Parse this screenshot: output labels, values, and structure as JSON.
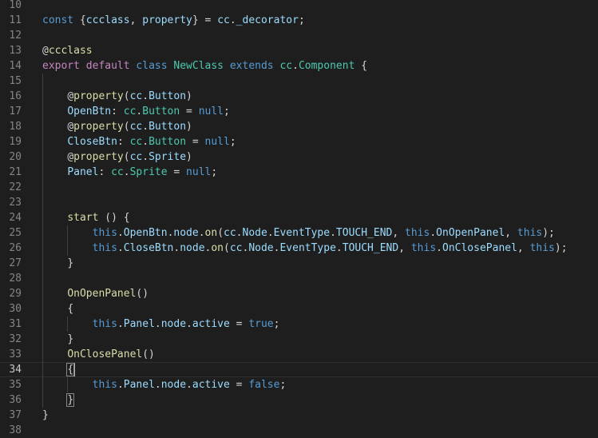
{
  "editor": {
    "current_line": 34,
    "theme_colors": {
      "background": "#1e1e1e",
      "line_number": "#858585",
      "keyword": "#569cd6",
      "storage": "#c586c0",
      "class_name": "#4ec9b0",
      "function": "#dcdcaa",
      "variable": "#9cdcfe",
      "punctuation": "#d4d4d4"
    },
    "lines": [
      {
        "n": "10",
        "indent": 0,
        "tokens": []
      },
      {
        "n": "11",
        "indent": 0,
        "tokens": [
          {
            "t": "const",
            "c": "#569cd6"
          },
          {
            "t": " {",
            "c": "#d4d4d4"
          },
          {
            "t": "ccclass",
            "c": "#9cdcfe"
          },
          {
            "t": ", ",
            "c": "#d4d4d4"
          },
          {
            "t": "property",
            "c": "#9cdcfe"
          },
          {
            "t": "} = ",
            "c": "#d4d4d4"
          },
          {
            "t": "cc",
            "c": "#9cdcfe"
          },
          {
            "t": ".",
            "c": "#d4d4d4"
          },
          {
            "t": "_decorator",
            "c": "#9cdcfe"
          },
          {
            "t": ";",
            "c": "#d4d4d4"
          }
        ]
      },
      {
        "n": "12",
        "indent": 0,
        "tokens": []
      },
      {
        "n": "13",
        "indent": 0,
        "tokens": [
          {
            "t": "@",
            "c": "#d4d4d4"
          },
          {
            "t": "ccclass",
            "c": "#dcdcaa"
          }
        ]
      },
      {
        "n": "14",
        "indent": 0,
        "tokens": [
          {
            "t": "export",
            "c": "#c586c0"
          },
          {
            "t": " ",
            "c": "#d4d4d4"
          },
          {
            "t": "default",
            "c": "#c586c0"
          },
          {
            "t": " ",
            "c": "#d4d4d4"
          },
          {
            "t": "class",
            "c": "#569cd6"
          },
          {
            "t": " ",
            "c": "#d4d4d4"
          },
          {
            "t": "NewClass",
            "c": "#4ec9b0"
          },
          {
            "t": " ",
            "c": "#d4d4d4"
          },
          {
            "t": "extends",
            "c": "#569cd6"
          },
          {
            "t": " ",
            "c": "#d4d4d4"
          },
          {
            "t": "cc",
            "c": "#4ec9b0"
          },
          {
            "t": ".",
            "c": "#d4d4d4"
          },
          {
            "t": "Component",
            "c": "#4ec9b0"
          },
          {
            "t": " {",
            "c": "#d4d4d4"
          }
        ]
      },
      {
        "n": "15",
        "indent": 1,
        "tokens": []
      },
      {
        "n": "16",
        "indent": 1,
        "tokens": [
          {
            "t": "@",
            "c": "#d4d4d4"
          },
          {
            "t": "property",
            "c": "#dcdcaa"
          },
          {
            "t": "(",
            "c": "#d4d4d4"
          },
          {
            "t": "cc",
            "c": "#9cdcfe"
          },
          {
            "t": ".",
            "c": "#d4d4d4"
          },
          {
            "t": "Button",
            "c": "#9cdcfe"
          },
          {
            "t": ")",
            "c": "#d4d4d4"
          }
        ]
      },
      {
        "n": "17",
        "indent": 1,
        "tokens": [
          {
            "t": "OpenBtn",
            "c": "#9cdcfe"
          },
          {
            "t": ": ",
            "c": "#d4d4d4"
          },
          {
            "t": "cc",
            "c": "#4ec9b0"
          },
          {
            "t": ".",
            "c": "#d4d4d4"
          },
          {
            "t": "Button",
            "c": "#4ec9b0"
          },
          {
            "t": " = ",
            "c": "#d4d4d4"
          },
          {
            "t": "null",
            "c": "#569cd6"
          },
          {
            "t": ";",
            "c": "#d4d4d4"
          }
        ]
      },
      {
        "n": "18",
        "indent": 1,
        "tokens": [
          {
            "t": "@",
            "c": "#d4d4d4"
          },
          {
            "t": "property",
            "c": "#dcdcaa"
          },
          {
            "t": "(",
            "c": "#d4d4d4"
          },
          {
            "t": "cc",
            "c": "#9cdcfe"
          },
          {
            "t": ".",
            "c": "#d4d4d4"
          },
          {
            "t": "Button",
            "c": "#9cdcfe"
          },
          {
            "t": ")",
            "c": "#d4d4d4"
          }
        ]
      },
      {
        "n": "19",
        "indent": 1,
        "tokens": [
          {
            "t": "CloseBtn",
            "c": "#9cdcfe"
          },
          {
            "t": ": ",
            "c": "#d4d4d4"
          },
          {
            "t": "cc",
            "c": "#4ec9b0"
          },
          {
            "t": ".",
            "c": "#d4d4d4"
          },
          {
            "t": "Button",
            "c": "#4ec9b0"
          },
          {
            "t": " = ",
            "c": "#d4d4d4"
          },
          {
            "t": "null",
            "c": "#569cd6"
          },
          {
            "t": ";",
            "c": "#d4d4d4"
          }
        ]
      },
      {
        "n": "20",
        "indent": 1,
        "tokens": [
          {
            "t": "@",
            "c": "#d4d4d4"
          },
          {
            "t": "property",
            "c": "#dcdcaa"
          },
          {
            "t": "(",
            "c": "#d4d4d4"
          },
          {
            "t": "cc",
            "c": "#9cdcfe"
          },
          {
            "t": ".",
            "c": "#d4d4d4"
          },
          {
            "t": "Sprite",
            "c": "#9cdcfe"
          },
          {
            "t": ")",
            "c": "#d4d4d4"
          }
        ]
      },
      {
        "n": "21",
        "indent": 1,
        "tokens": [
          {
            "t": "Panel",
            "c": "#9cdcfe"
          },
          {
            "t": ": ",
            "c": "#d4d4d4"
          },
          {
            "t": "cc",
            "c": "#4ec9b0"
          },
          {
            "t": ".",
            "c": "#d4d4d4"
          },
          {
            "t": "Sprite",
            "c": "#4ec9b0"
          },
          {
            "t": " = ",
            "c": "#d4d4d4"
          },
          {
            "t": "null",
            "c": "#569cd6"
          },
          {
            "t": ";",
            "c": "#d4d4d4"
          }
        ]
      },
      {
        "n": "22",
        "indent": 1,
        "tokens": []
      },
      {
        "n": "23",
        "indent": 1,
        "tokens": []
      },
      {
        "n": "24",
        "indent": 1,
        "tokens": [
          {
            "t": "start",
            "c": "#dcdcaa"
          },
          {
            "t": " () {",
            "c": "#d4d4d4"
          }
        ]
      },
      {
        "n": "25",
        "indent": 2,
        "tokens": [
          {
            "t": "this",
            "c": "#569cd6"
          },
          {
            "t": ".",
            "c": "#d4d4d4"
          },
          {
            "t": "OpenBtn",
            "c": "#9cdcfe"
          },
          {
            "t": ".",
            "c": "#d4d4d4"
          },
          {
            "t": "node",
            "c": "#9cdcfe"
          },
          {
            "t": ".",
            "c": "#d4d4d4"
          },
          {
            "t": "on",
            "c": "#dcdcaa"
          },
          {
            "t": "(",
            "c": "#d4d4d4"
          },
          {
            "t": "cc",
            "c": "#9cdcfe"
          },
          {
            "t": ".",
            "c": "#d4d4d4"
          },
          {
            "t": "Node",
            "c": "#9cdcfe"
          },
          {
            "t": ".",
            "c": "#d4d4d4"
          },
          {
            "t": "EventType",
            "c": "#9cdcfe"
          },
          {
            "t": ".",
            "c": "#d4d4d4"
          },
          {
            "t": "TOUCH_END",
            "c": "#9cdcfe"
          },
          {
            "t": ", ",
            "c": "#d4d4d4"
          },
          {
            "t": "this",
            "c": "#569cd6"
          },
          {
            "t": ".",
            "c": "#d4d4d4"
          },
          {
            "t": "OnOpenPanel",
            "c": "#9cdcfe"
          },
          {
            "t": ", ",
            "c": "#d4d4d4"
          },
          {
            "t": "this",
            "c": "#569cd6"
          },
          {
            "t": ");",
            "c": "#d4d4d4"
          }
        ]
      },
      {
        "n": "26",
        "indent": 2,
        "tokens": [
          {
            "t": "this",
            "c": "#569cd6"
          },
          {
            "t": ".",
            "c": "#d4d4d4"
          },
          {
            "t": "CloseBtn",
            "c": "#9cdcfe"
          },
          {
            "t": ".",
            "c": "#d4d4d4"
          },
          {
            "t": "node",
            "c": "#9cdcfe"
          },
          {
            "t": ".",
            "c": "#d4d4d4"
          },
          {
            "t": "on",
            "c": "#dcdcaa"
          },
          {
            "t": "(",
            "c": "#d4d4d4"
          },
          {
            "t": "cc",
            "c": "#9cdcfe"
          },
          {
            "t": ".",
            "c": "#d4d4d4"
          },
          {
            "t": "Node",
            "c": "#9cdcfe"
          },
          {
            "t": ".",
            "c": "#d4d4d4"
          },
          {
            "t": "EventType",
            "c": "#9cdcfe"
          },
          {
            "t": ".",
            "c": "#d4d4d4"
          },
          {
            "t": "TOUCH_END",
            "c": "#9cdcfe"
          },
          {
            "t": ", ",
            "c": "#d4d4d4"
          },
          {
            "t": "this",
            "c": "#569cd6"
          },
          {
            "t": ".",
            "c": "#d4d4d4"
          },
          {
            "t": "OnClosePanel",
            "c": "#9cdcfe"
          },
          {
            "t": ", ",
            "c": "#d4d4d4"
          },
          {
            "t": "this",
            "c": "#569cd6"
          },
          {
            "t": ");",
            "c": "#d4d4d4"
          }
        ]
      },
      {
        "n": "27",
        "indent": 1,
        "tokens": [
          {
            "t": "}",
            "c": "#d4d4d4"
          }
        ]
      },
      {
        "n": "28",
        "indent": 1,
        "tokens": []
      },
      {
        "n": "29",
        "indent": 1,
        "tokens": [
          {
            "t": "OnOpenPanel",
            "c": "#dcdcaa"
          },
          {
            "t": "()",
            "c": "#d4d4d4"
          }
        ]
      },
      {
        "n": "30",
        "indent": 1,
        "tokens": [
          {
            "t": "{",
            "c": "#d4d4d4"
          }
        ]
      },
      {
        "n": "31",
        "indent": 2,
        "tokens": [
          {
            "t": "this",
            "c": "#569cd6"
          },
          {
            "t": ".",
            "c": "#d4d4d4"
          },
          {
            "t": "Panel",
            "c": "#9cdcfe"
          },
          {
            "t": ".",
            "c": "#d4d4d4"
          },
          {
            "t": "node",
            "c": "#9cdcfe"
          },
          {
            "t": ".",
            "c": "#d4d4d4"
          },
          {
            "t": "active",
            "c": "#9cdcfe"
          },
          {
            "t": " = ",
            "c": "#d4d4d4"
          },
          {
            "t": "true",
            "c": "#569cd6"
          },
          {
            "t": ";",
            "c": "#d4d4d4"
          }
        ]
      },
      {
        "n": "32",
        "indent": 1,
        "tokens": [
          {
            "t": "}",
            "c": "#d4d4d4"
          }
        ]
      },
      {
        "n": "33",
        "indent": 1,
        "tokens": [
          {
            "t": "OnClosePanel",
            "c": "#dcdcaa"
          },
          {
            "t": "()",
            "c": "#d4d4d4"
          }
        ]
      },
      {
        "n": "34",
        "indent": 1,
        "tokens": [
          {
            "t": "{",
            "c": "#d4d4d4",
            "match": true
          }
        ]
      },
      {
        "n": "35",
        "indent": 2,
        "tokens": [
          {
            "t": "this",
            "c": "#569cd6"
          },
          {
            "t": ".",
            "c": "#d4d4d4"
          },
          {
            "t": "Panel",
            "c": "#9cdcfe"
          },
          {
            "t": ".",
            "c": "#d4d4d4"
          },
          {
            "t": "node",
            "c": "#9cdcfe"
          },
          {
            "t": ".",
            "c": "#d4d4d4"
          },
          {
            "t": "active",
            "c": "#9cdcfe"
          },
          {
            "t": " = ",
            "c": "#d4d4d4"
          },
          {
            "t": "false",
            "c": "#569cd6"
          },
          {
            "t": ";",
            "c": "#d4d4d4"
          }
        ]
      },
      {
        "n": "36",
        "indent": 1,
        "tokens": [
          {
            "t": "}",
            "c": "#d4d4d4",
            "match": true
          }
        ]
      },
      {
        "n": "37",
        "indent": 0,
        "tokens": [
          {
            "t": "}",
            "c": "#d4d4d4"
          }
        ]
      },
      {
        "n": "38",
        "indent": 0,
        "tokens": []
      }
    ]
  }
}
